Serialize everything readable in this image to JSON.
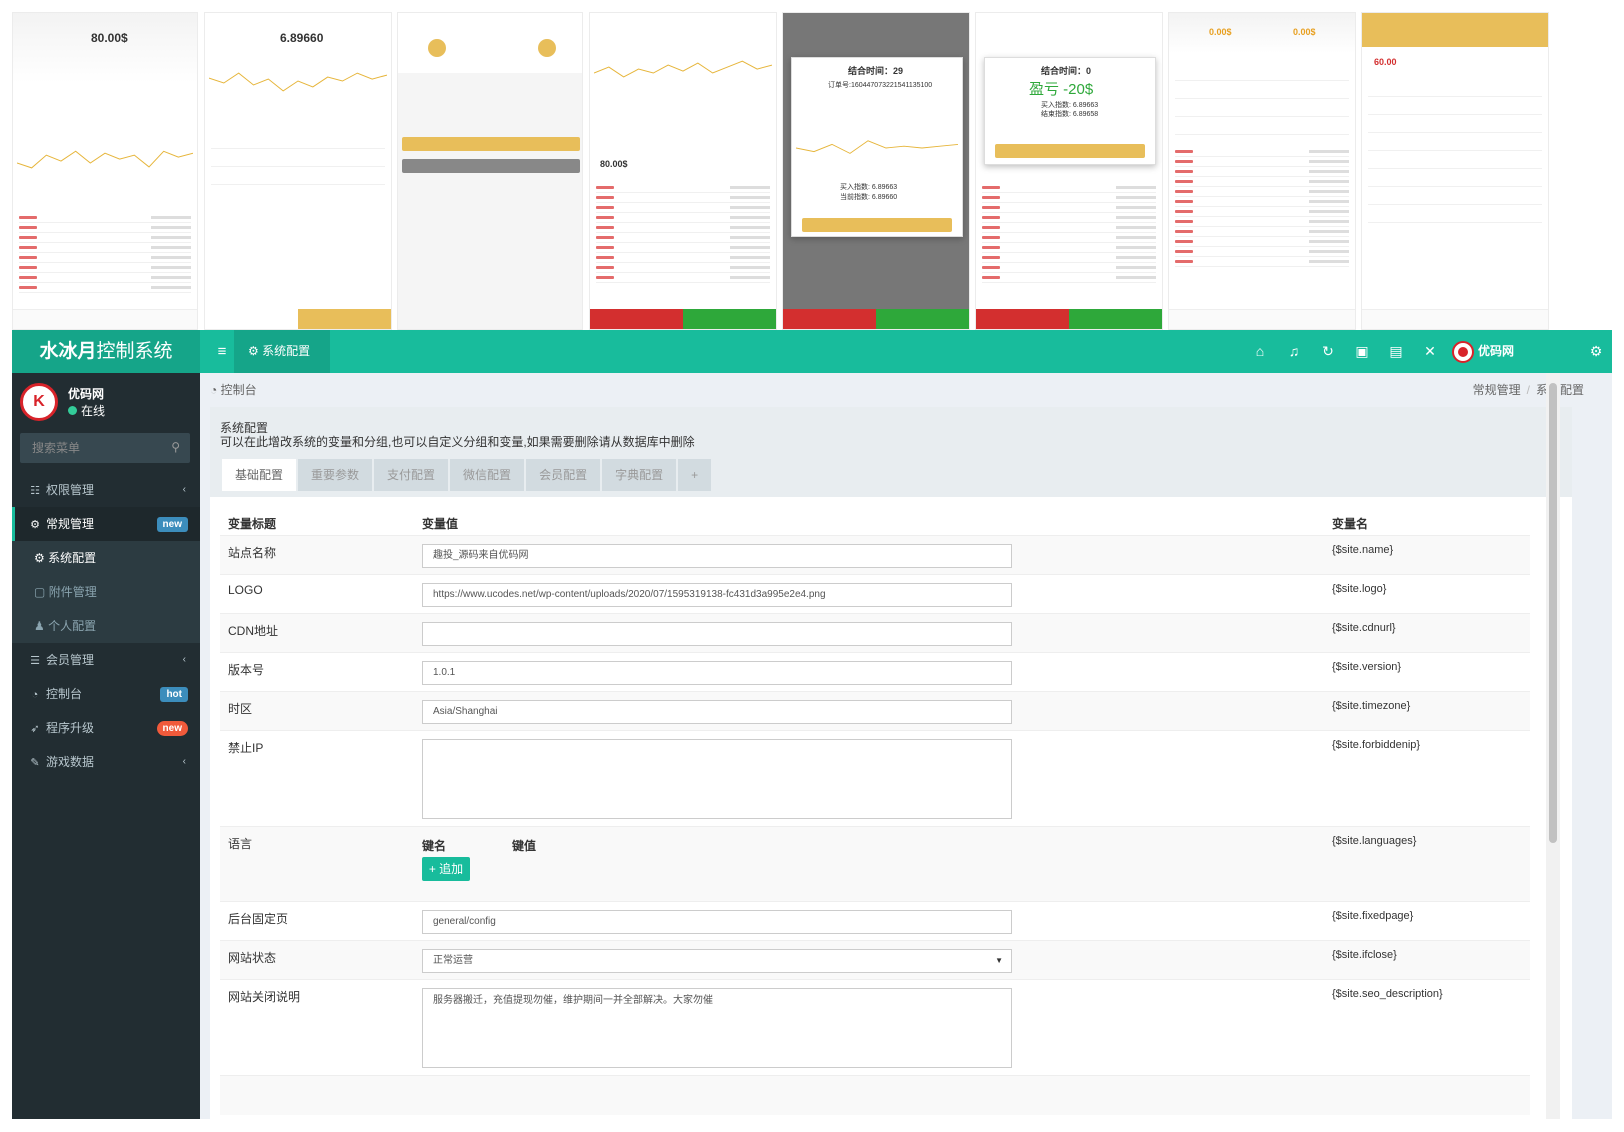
{
  "app": {
    "brand_bold": "水冰月",
    "brand_rest": "控制系统",
    "active_tab": "系统配置"
  },
  "user": {
    "name": "优码网",
    "status": "在线"
  },
  "search": {
    "placeholder": "搜索菜单"
  },
  "sidebar": {
    "items": [
      {
        "label": "权限管理"
      },
      {
        "label": "常规管理",
        "badge": "new"
      },
      {
        "label": "系统配置"
      },
      {
        "label": "附件管理"
      },
      {
        "label": "个人配置"
      },
      {
        "label": "会员管理"
      },
      {
        "label": "控制台",
        "badge": "hot"
      },
      {
        "label": "程序升级",
        "badge": "new"
      },
      {
        "label": "游戏数据"
      }
    ]
  },
  "breadcrumb": {
    "home": "控制台",
    "parent": "常规管理",
    "current": "系统配置"
  },
  "panel": {
    "title": "系统配置",
    "desc": "可以在此增改系统的变量和分组,也可以自定义分组和变量,如果需要删除请从数据库中删除"
  },
  "tabs": [
    "基础配置",
    "重要参数",
    "支付配置",
    "微信配置",
    "会员配置",
    "字典配置",
    "+"
  ],
  "table": {
    "headers": [
      "变量标题",
      "变量值",
      "变量名"
    ],
    "rows": [
      {
        "label": "站点名称",
        "value": "趣投_源码来自优码网",
        "name": "{$site.name}"
      },
      {
        "label": "LOGO",
        "value": "https://www.ucodes.net/wp-content/uploads/2020/07/1595319138-fc431d3a995e2e4.png",
        "name": "{$site.logo}"
      },
      {
        "label": "CDN地址",
        "value": "",
        "name": "{$site.cdnurl}"
      },
      {
        "label": "版本号",
        "value": "1.0.1",
        "name": "{$site.version}"
      },
      {
        "label": "时区",
        "value": "Asia/Shanghai",
        "name": "{$site.timezone}"
      },
      {
        "label": "禁止IP",
        "value": "",
        "name": "{$site.forbiddenip}"
      },
      {
        "label": "语言",
        "key_label": "键名",
        "val_label": "键值",
        "add_label": "+ 追加",
        "name": "{$site.languages}"
      },
      {
        "label": "后台固定页",
        "value": "general/config",
        "name": "{$site.fixedpage}"
      },
      {
        "label": "网站状态",
        "value": "正常运营",
        "name": "{$site.ifclose}"
      },
      {
        "label": "网站关闭说明",
        "value": "服务器搬迁，充值提现勿催，维护期间一并全部解决。大家勿催",
        "name": "{$site.seo_description}"
      }
    ]
  },
  "colors": {
    "primary": "#18bc9c",
    "sidebar": "#222d32",
    "gold": "#e8be5a"
  },
  "collage": {
    "phone1": {
      "balance": "80.00$"
    },
    "phone2": {
      "rate": "6.89660"
    },
    "phone4": {
      "balance": "80.00$"
    },
    "phone5": {
      "title": "结合时间：29",
      "order": "订单号:1604470732215411351​00",
      "buy": "买入指数: 6.89663",
      "settle": "当前指数: 6.89660"
    },
    "phone6": {
      "title": "结合时间：0",
      "result": "盈亏 -20$",
      "buy": "买入指数: 6.89663",
      "settle": "结束指数: 6.89658"
    },
    "phone7": {
      "a": "0.00$",
      "b": "0.00$"
    },
    "phone8": {
      "balance": "60.00"
    }
  }
}
